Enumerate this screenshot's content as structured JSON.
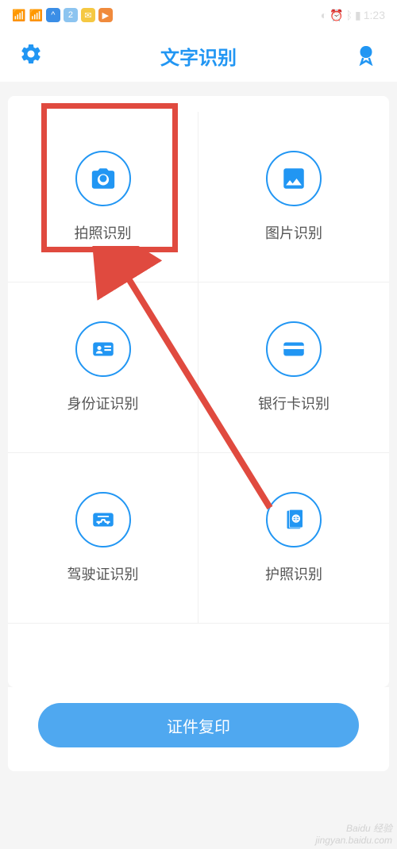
{
  "statusbar": {
    "time": "1:23"
  },
  "header": {
    "title": "文字识别"
  },
  "grid": {
    "items": [
      {
        "label": "拍照识别"
      },
      {
        "label": "图片识别"
      },
      {
        "label": "身份证识别"
      },
      {
        "label": "银行卡识别"
      },
      {
        "label": "驾驶证识别"
      },
      {
        "label": "护照识别"
      }
    ]
  },
  "footer": {
    "button_label": "证件复印"
  },
  "watermark": {
    "line1": "Baidu 经验",
    "line2": "jingyan.baidu.com"
  },
  "colors": {
    "accent": "#2196f3",
    "highlight": "#e04a3f",
    "button": "#4fa8f0"
  }
}
